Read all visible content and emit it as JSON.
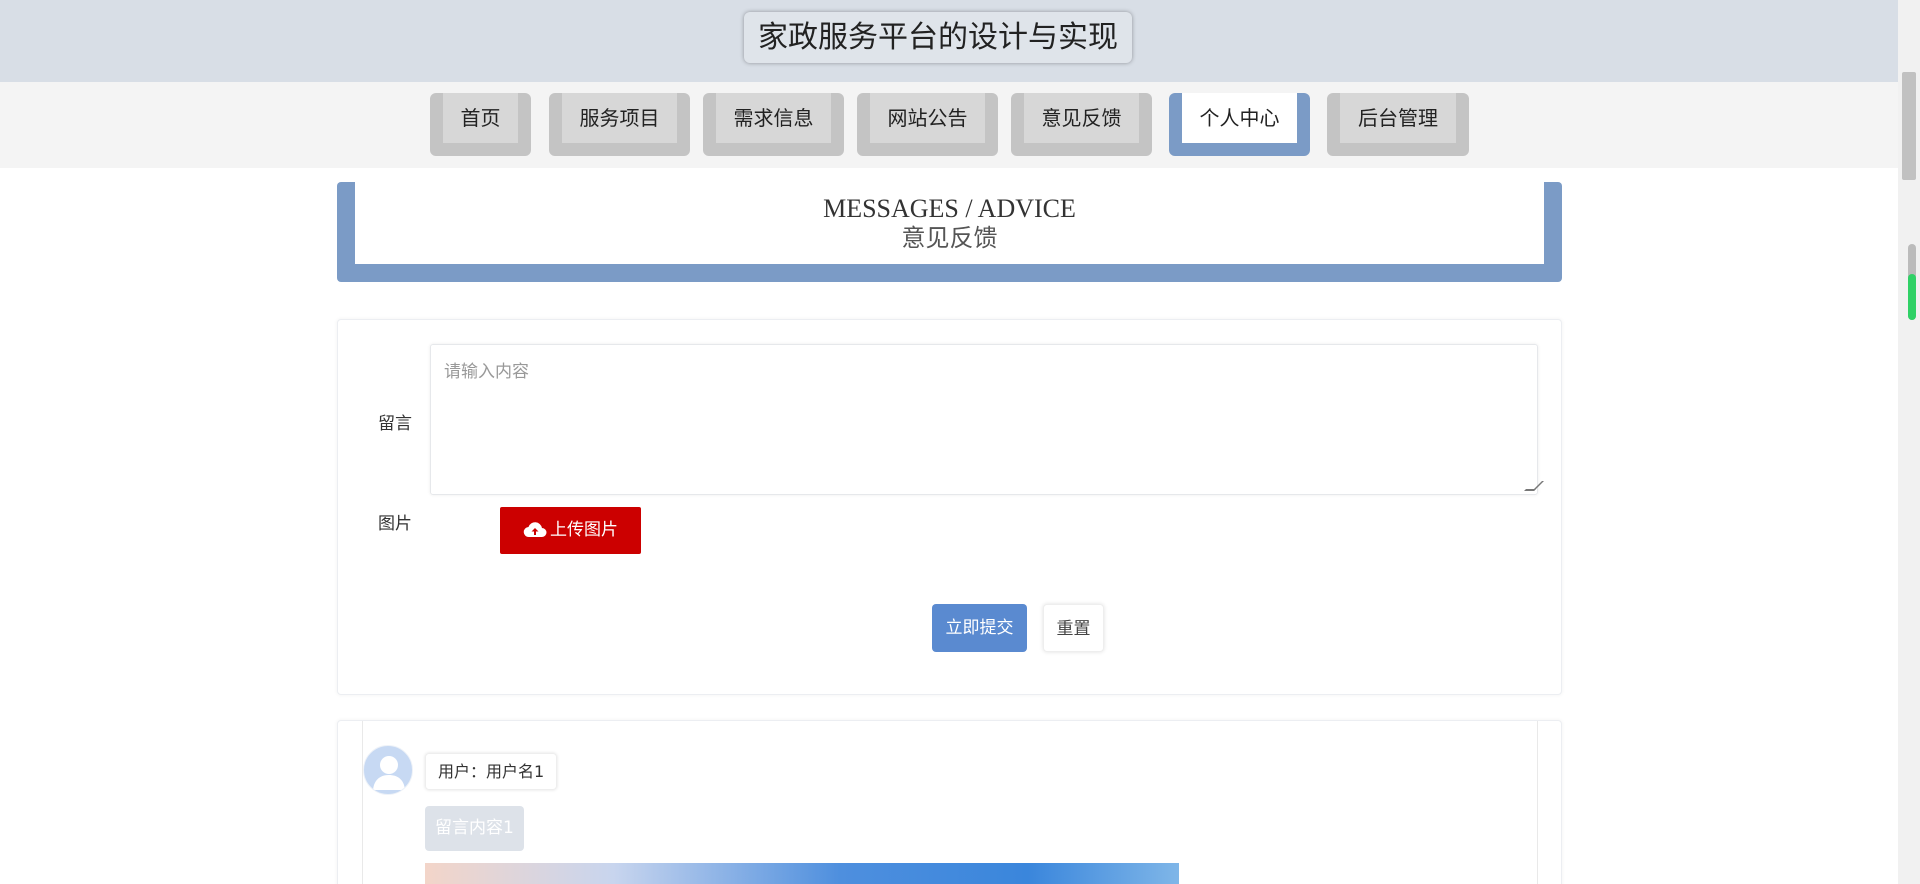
{
  "header": {
    "title": "家政服务平台的设计与实现"
  },
  "nav": {
    "items": [
      {
        "label": "首页",
        "active": false
      },
      {
        "label": "服务项目",
        "active": false
      },
      {
        "label": "需求信息",
        "active": false
      },
      {
        "label": "网站公告",
        "active": false
      },
      {
        "label": "意见反馈",
        "active": false
      },
      {
        "label": "个人中心",
        "active": true
      },
      {
        "label": "后台管理",
        "active": false
      }
    ]
  },
  "banner": {
    "title_en": "MESSAGES / ADVICE",
    "title_cn": "意见反馈"
  },
  "form": {
    "message_label": "留言",
    "message_placeholder": "请输入内容",
    "message_value": "",
    "image_label": "图片",
    "upload_label": "上传图片",
    "submit_label": "立即提交",
    "reset_label": "重置"
  },
  "messages": [
    {
      "user_prefix": "用户：",
      "username": "用户名1",
      "content": "留言内容1"
    }
  ],
  "colors": {
    "accent": "#7b9bc6",
    "submit": "#5a8ad0",
    "upload": "#cc0000",
    "header_bg": "#d8dee6"
  },
  "icons": {
    "upload": "cloud-upload-icon",
    "avatar": "user-avatar-icon"
  }
}
